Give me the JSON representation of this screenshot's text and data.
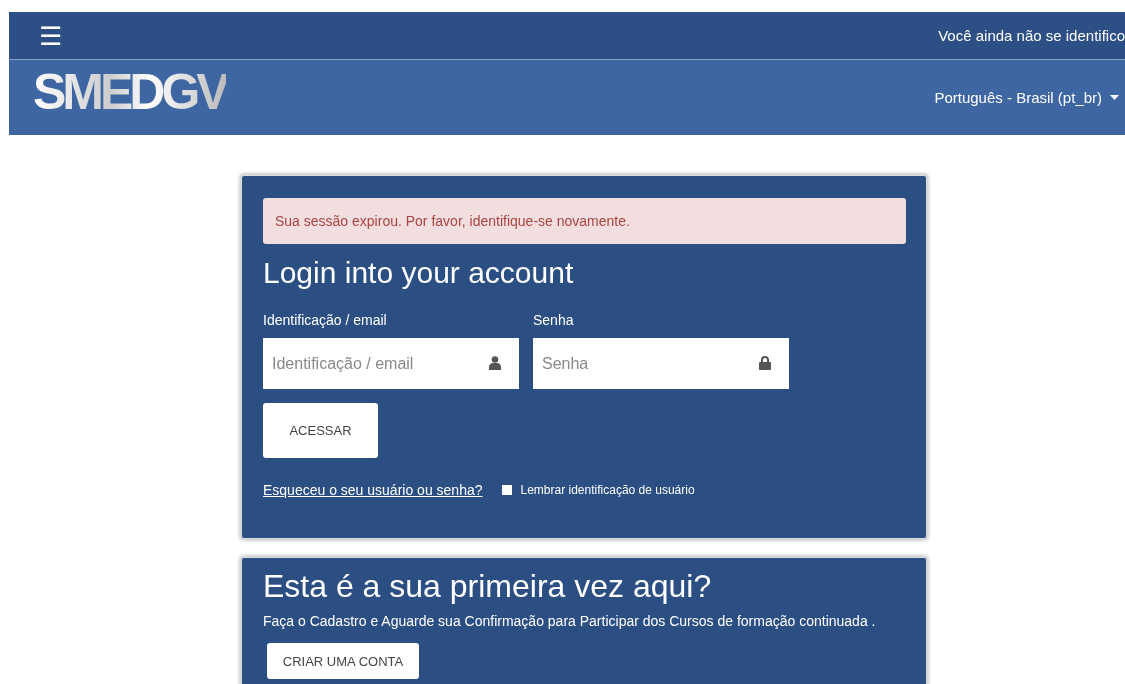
{
  "navbar": {
    "menu_icon": "☰",
    "login_status": "Você ainda não se identifico"
  },
  "header": {
    "logo": "SMEDGV",
    "language": "Português - Brasil (pt_br)"
  },
  "login_card": {
    "alert": "Sua sessão expirou. Por favor, identifique-se novamente.",
    "title": "Login into your account",
    "fields": [
      {
        "label": "Identificação / email",
        "placeholder": "Identificação / email",
        "kind": "user"
      },
      {
        "label": "Senha",
        "placeholder": "Senha",
        "kind": "password"
      }
    ],
    "submit": "ACESSAR",
    "forgot_link": "Esqueceu o seu usuário ou senha?",
    "remember": {
      "label": "Lembrar identificação de usuário",
      "checked": false
    }
  },
  "signup_card": {
    "title": "Esta é a sua primeira vez aqui?",
    "text": "Faça o Cadastro e Aguarde sua Confirmação para Participar dos Cursos de formação continuada .",
    "button": "CRIAR UMA CONTA"
  }
}
